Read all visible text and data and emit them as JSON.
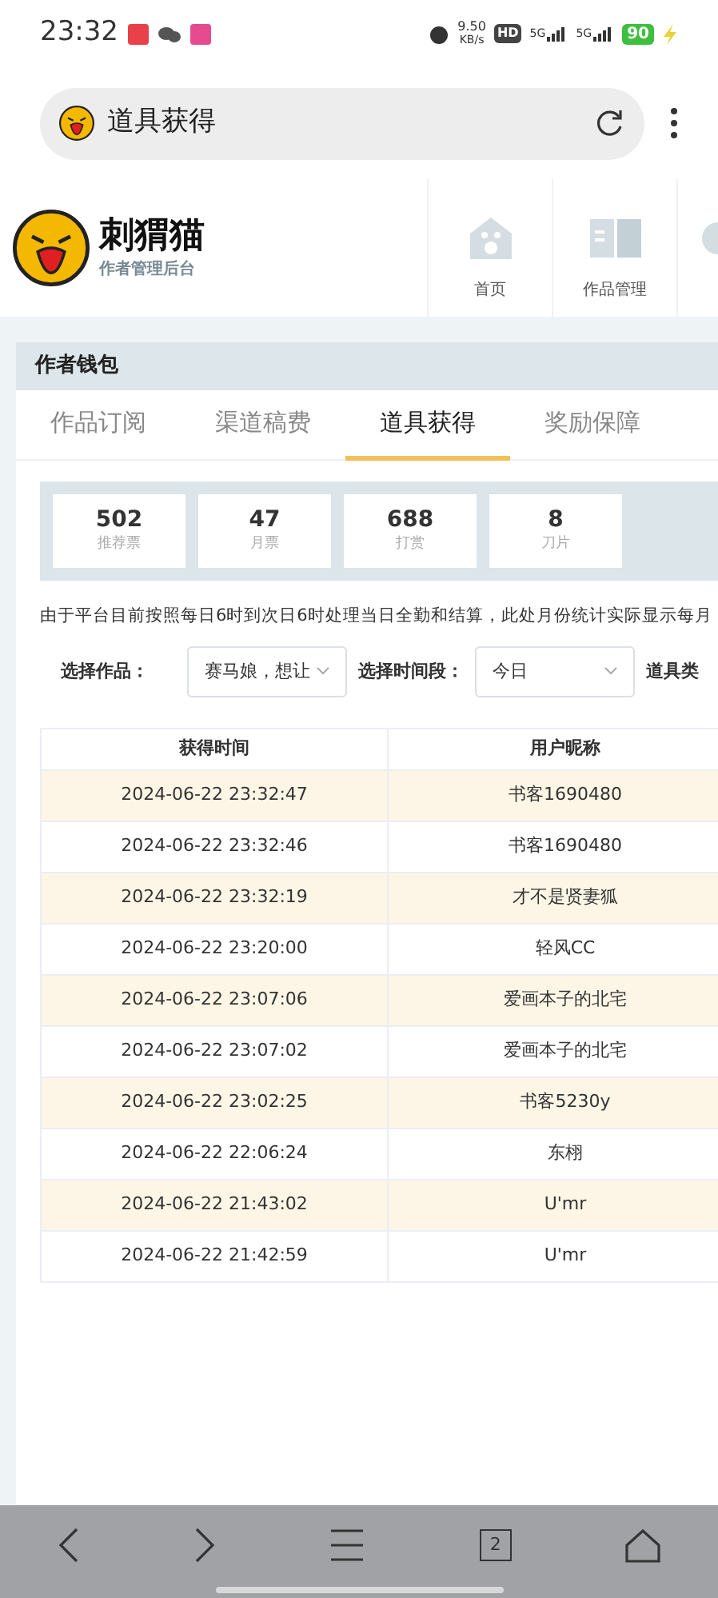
{
  "status_bar": {
    "time": "23:32",
    "speed": "9.50",
    "speed_unit": "KB/s",
    "hd": "HD",
    "signals": [
      "5G",
      "5G"
    ],
    "battery": "90"
  },
  "browser": {
    "title": "道具获得"
  },
  "header": {
    "brand": "刺猬猫",
    "subtitle": "作者管理后台",
    "nav": [
      {
        "label": "首页",
        "kind": "home"
      },
      {
        "label": "作品管理",
        "kind": "book"
      },
      {
        "kind": "partial"
      }
    ]
  },
  "panel": {
    "title": "作者钱包"
  },
  "tabs": [
    {
      "label": "作品订阅",
      "selected": false
    },
    {
      "label": "渠道稿费",
      "selected": false
    },
    {
      "label": "道具获得",
      "selected": true
    },
    {
      "label": "奖励保障",
      "selected": false
    }
  ],
  "stats": [
    {
      "value": "502",
      "label": "推荐票"
    },
    {
      "value": "47",
      "label": "月票"
    },
    {
      "value": "688",
      "label": "打赏"
    },
    {
      "value": "8",
      "label": "刀片"
    }
  ],
  "notice": "由于平台目前按照每日6时到次日6时处理当日全勤和结算，此处月份统计实际显示每月",
  "filters": [
    {
      "label": "选择作品：",
      "value": "赛马娘，想让"
    },
    {
      "label": "选择时间段：",
      "value": "今日"
    },
    {
      "label": "道具类"
    }
  ],
  "table": {
    "columns": [
      "获得时间",
      "用户昵称"
    ],
    "rows": [
      [
        "2024-06-22 23:32:47",
        "书客1690480"
      ],
      [
        "2024-06-22 23:32:46",
        "书客1690480"
      ],
      [
        "2024-06-22 23:32:19",
        "才不是贤妻狐"
      ],
      [
        "2024-06-22 23:20:00",
        "轻风CC"
      ],
      [
        "2024-06-22 23:07:06",
        "爱画本子的北宅"
      ],
      [
        "2024-06-22 23:07:02",
        "爱画本子的北宅"
      ],
      [
        "2024-06-22 23:02:25",
        "书客5230y"
      ],
      [
        "2024-06-22 22:06:24",
        "东栩"
      ],
      [
        "2024-06-22 21:43:02",
        "U'mr"
      ],
      [
        "2024-06-22 21:42:59",
        "U'mr"
      ]
    ]
  },
  "bottom_nav": {
    "tab_count": "2"
  }
}
